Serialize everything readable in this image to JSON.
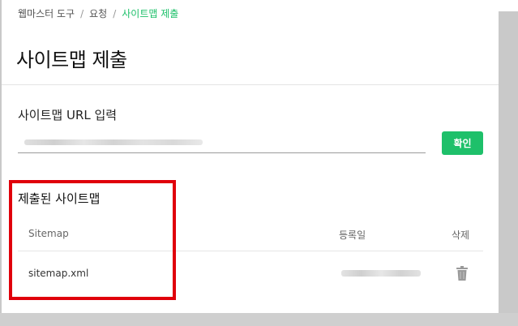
{
  "breadcrumb": {
    "items": [
      "웹마스터 도구",
      "요청",
      "사이트맵 제출"
    ],
    "separator": "/"
  },
  "page": {
    "title": "사이트맵 제출"
  },
  "submit_form": {
    "label": "사이트맵 URL 입력",
    "input_value": "",
    "button_label": "확인"
  },
  "submitted": {
    "title": "제출된 사이트맵",
    "columns": [
      "Sitemap",
      "등록일",
      "삭제"
    ],
    "rows": [
      {
        "sitemap": "sitemap.xml",
        "delete_icon": "trash-icon"
      }
    ]
  },
  "colors": {
    "accent": "#1ec06a",
    "highlight": "#e0000b"
  }
}
